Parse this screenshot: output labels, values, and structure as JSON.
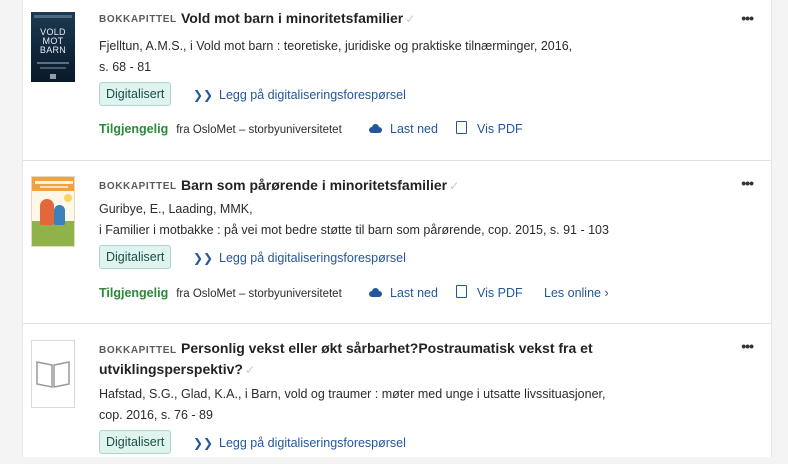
{
  "records": [
    {
      "type": "BOKKAPITTEL",
      "title": "Vold mot barn i minoritetsfamilier",
      "check": "✓",
      "meta_line1": "Fjelltun, A.M.S., i Vold mot barn : teoretiske, juridiske og praktiske tilnærminger, 2016,",
      "meta_line2": "s. 68 - 81",
      "badge": "Digitalisert",
      "digi_request": "Legg på digitaliseringsforespørsel",
      "availability": "Tilgjengelig",
      "from": "fra OsloMet – storbyuniversitetet",
      "download": "Last ned",
      "pdf": "Vis PDF",
      "cover": {
        "w1": "VOLD",
        "w2": "MOT",
        "w3": "BARN"
      },
      "more": "•••"
    },
    {
      "type": "BOKKAPITTEL",
      "title": "Barn som pårørende i minoritetsfamilier",
      "check": "✓",
      "meta_line1": "Guribye, E., Laading, MMK,",
      "meta_line2": "i Familier i motbakke : på vei mot bedre støtte til barn som pårørende, cop. 2015, s. 91 - 103",
      "badge": "Digitalisert",
      "digi_request": "Legg på digitaliseringsforespørsel",
      "availability": "Tilgjengelig",
      "from": "fra OsloMet – storbyuniversitetet",
      "download": "Last ned",
      "pdf": "Vis PDF",
      "read_online": "Les online ›",
      "more": "•••"
    },
    {
      "type": "BOKKAPITTEL",
      "title_line1": "Personlig vekst eller økt sårbarhet?Postraumatisk vekst fra et",
      "title_line2": "utviklingsperspektiv?",
      "check": "✓",
      "meta_line1": "Hafstad, S.G., Glad, K.A., i Barn, vold og traumer : møter med unge i utsatte livssituasjoner,",
      "meta_line2": "cop. 2016, s. 76 - 89",
      "badge": "Digitalisert",
      "digi_request": "Legg på digitaliseringsforespørsel",
      "more": "•••"
    }
  ],
  "colors": {
    "link": "#24579a",
    "available": "#2a8a38",
    "badge_bg": "#dff3ef",
    "badge_border": "#a9d7cf"
  },
  "icons": {
    "digi": "double-chevron-icon",
    "download": "cloud-download-icon",
    "pdf": "pdf-file-icon",
    "more": "more-options-icon",
    "placeholder": "book-placeholder-icon"
  }
}
